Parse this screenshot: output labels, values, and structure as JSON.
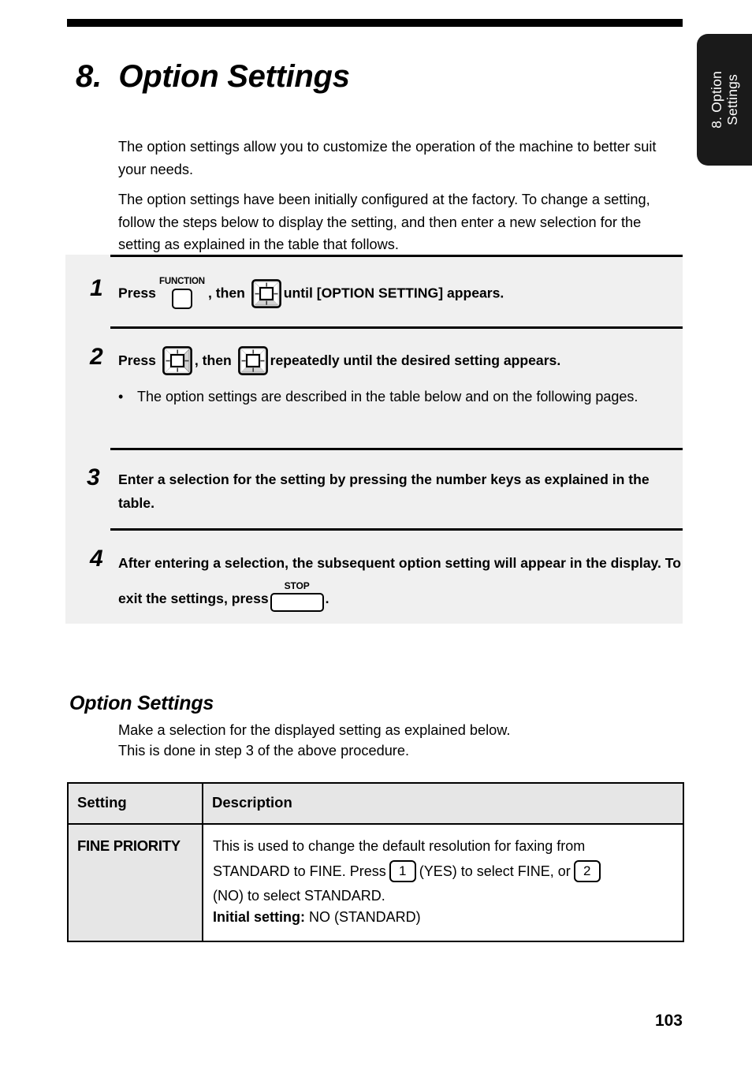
{
  "document": {
    "chapter_number": "8.",
    "chapter_title": "8.  Option Settings",
    "side_tab_label": "8. Option\nSettings",
    "page_number": "103"
  },
  "intro": {
    "paragraph_1": "The option settings allow you to customize the operation of the machine to better suit your needs.",
    "paragraph_2": "The option settings have been initially configured at the factory. To change a setting, follow the steps below to display the setting, and then enter a new selection for the setting as explained in the table that follows."
  },
  "steps": {
    "step1": {
      "number": "1",
      "text_before_function_key": "Press",
      "function_key_label": "FUNCTION",
      "text_middle": ", then",
      "text_after": "until [OPTION SETTING] appears."
    },
    "step2": {
      "number": "2",
      "text_before": "Press",
      "text_middle": ", then",
      "text_after": "repeatedly until the desired setting appears.",
      "note_bullet": "•",
      "note": "The option settings are described in the table below and on the following pages."
    },
    "step3": {
      "number": "3",
      "text": "Enter a selection for the setting by pressing the number keys as explained in the table."
    },
    "step4": {
      "number": "4",
      "text_line1": "After entering a selection, the subsequent option setting will appear in",
      "text_line2_before": "the display. To exit the settings, press",
      "stop_key_label": "STOP",
      "text_line2_after": "."
    }
  },
  "section": {
    "heading": "Option Settings",
    "lead_line1": "Make a selection for the displayed setting as explained below.",
    "lead_line2": "This is done in step 3 of the above procedure."
  },
  "table": {
    "headers": [
      "Setting",
      "Description"
    ],
    "rows": [
      {
        "setting": "FINE PRIORITY",
        "desc_line1": "This is used to change the default resolution for faxing from",
        "desc_line2_a": "STANDARD to FINE. Press",
        "key_yes": "1",
        "desc_line2_b": "(YES) to select FINE, or",
        "key_no": "2",
        "desc_line3": "(NO) to select STANDARD.",
        "initial_label": "Initial setting:",
        "initial_value": " NO (STANDARD)"
      }
    ]
  },
  "colors": {
    "panel_background": "#f0f0f0",
    "table_header_background": "#e6e6e6",
    "tab_background": "#1a1a1a",
    "rule": "#000000",
    "key_shadow": "#c8c8c8"
  }
}
